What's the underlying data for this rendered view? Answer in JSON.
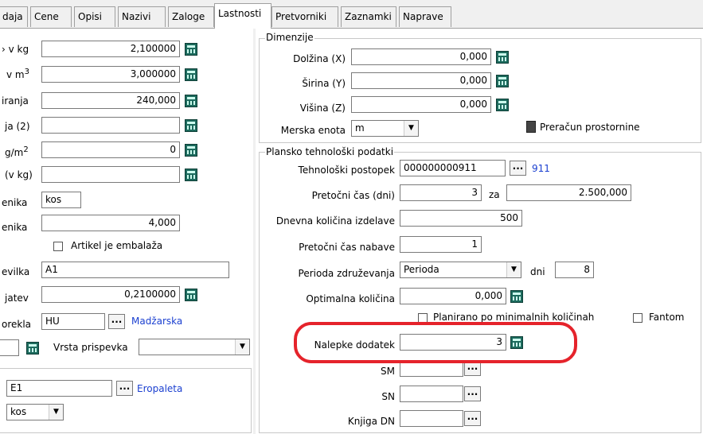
{
  "tabs": [
    "daja",
    "Cene",
    "Opisi",
    "Nazivi",
    "Zaloge",
    "Lastnosti",
    "Pretvorniki",
    "Zaznamki",
    "Naprave"
  ],
  "active_tab": "Lastnosti",
  "left": {
    "masa_label": "› v kg",
    "masa_value": "2,100000",
    "volumen_label": "v m",
    "volumen_sup": "3",
    "volumen_value": "3,000000",
    "iranja_label": "iranja",
    "iranja_value": "240,000",
    "ja2_label": "ja (2)",
    "ja2_value": "",
    "gm2_label": "g/m",
    "gm2_sup": "2",
    "gm2_value": "0",
    "vkg_label": "(v kg)",
    "vkg_value": "",
    "enota1_label": "enika",
    "enota1_value": "kos",
    "enota2_label": "enika",
    "enota2_value": "4,000",
    "embalaza_label": "Artikel je embalaža",
    "stevilka_label": "evilka",
    "stevilka_value": "A1",
    "jatev_label": "jatev",
    "jatev_value": "0,2100000",
    "porekla_label": "orekla",
    "porekla_value": "HU",
    "porekla_name": "Madžarska",
    "prispevek_label": "Vrsta prispevka",
    "prispevek_value": "",
    "paleta_value": "E1",
    "paleta_name": "Eropaleta",
    "paleta_enota": "kos"
  },
  "dimenzije": {
    "title": "Dimenzije",
    "dolzina_label": "Dolžina (X)",
    "dolzina_value": "0,000",
    "sirina_label": "Širina (Y)",
    "sirina_value": "0,000",
    "visina_label": "Višina (Z)",
    "visina_value": "0,000",
    "enota_label": "Merska enota",
    "enota_value": "m",
    "preracun_label": "Preračun prostornine"
  },
  "plansko": {
    "title": "Plansko tehnološki podatki",
    "postopek_label": "Tehnološki postopek",
    "postopek_value": "000000000911",
    "postopek_link": "911",
    "pretocni_label": "Pretočni čas (dni)",
    "pretocni_value": "3",
    "za_label": "za",
    "za_value": "2.500,000",
    "dnevna_label": "Dnevna količina izdelave",
    "dnevna_value": "500",
    "nabave_label": "Pretočni čas nabave",
    "nabave_value": "1",
    "perioda_label": "Perioda združevanja",
    "perioda_value": "Perioda",
    "dni_label": "dni",
    "dni_value": "8",
    "optimalna_label": "Optimalna količina",
    "optimalna_value": "0,000",
    "planirano_label": "Planirano po minimalnih količinah",
    "fantom_label": "Fantom",
    "nalepke_label": "Nalepke dodatek",
    "nalepke_value": "3",
    "sm_label": "SM",
    "sm_value": "",
    "sn_label": "SN",
    "sn_value": "",
    "knjiga_label": "Knjiga DN",
    "knjiga_value": ""
  }
}
